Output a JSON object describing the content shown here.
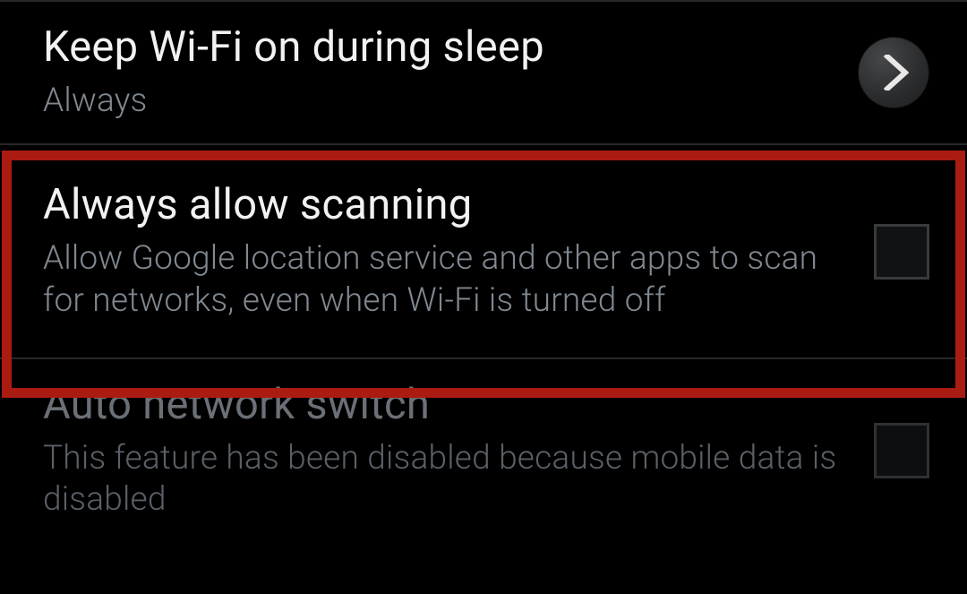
{
  "settings": [
    {
      "title": "Keep Wi-Fi on during sleep",
      "subtitle": "Always",
      "control": "arrow",
      "disabled": false
    },
    {
      "title": "Always allow scanning",
      "subtitle": "Allow Google location service and other apps to scan for networks, even when Wi-Fi is turned off",
      "control": "checkbox",
      "disabled": false
    },
    {
      "title": "Auto network switch",
      "subtitle": "This feature has been disabled because mobile data is disabled",
      "control": "checkbox",
      "disabled": true
    }
  ]
}
